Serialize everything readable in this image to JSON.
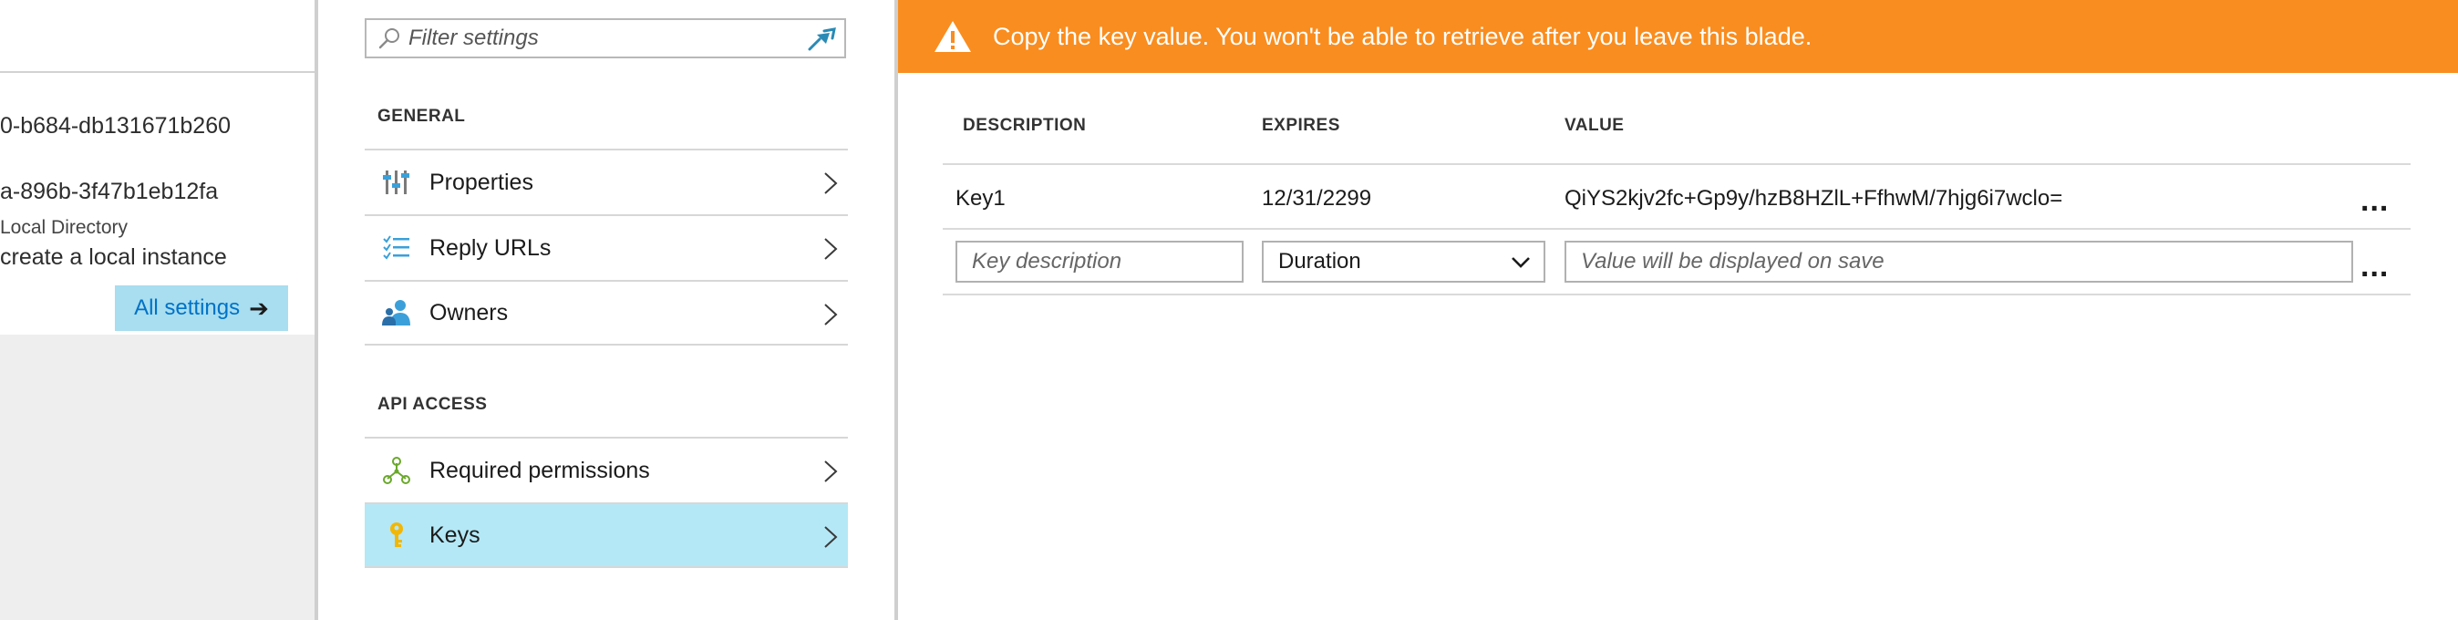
{
  "left_blade": {
    "line1": "0-b684-db131671b260",
    "line2": "a-896b-3f47b1eb12fa",
    "line3": "Local Directory",
    "line4": "create a local instance",
    "all_settings_label": "All settings",
    "all_settings_arrow": "➔"
  },
  "settings_blade": {
    "filter_placeholder": "Filter settings",
    "sections": [
      {
        "title": "GENERAL",
        "items": [
          {
            "label": "Properties",
            "icon": "properties-icon"
          },
          {
            "label": "Reply URLs",
            "icon": "reply-urls-icon"
          },
          {
            "label": "Owners",
            "icon": "owners-icon"
          }
        ]
      },
      {
        "title": "API ACCESS",
        "items": [
          {
            "label": "Required permissions",
            "icon": "permissions-icon"
          },
          {
            "label": "Keys",
            "icon": "key-icon",
            "selected": true
          }
        ]
      }
    ]
  },
  "keys_blade": {
    "warning": "Copy the key value. You won't be able to retrieve after you leave this blade.",
    "columns": {
      "description": "DESCRIPTION",
      "expires": "EXPIRES",
      "value": "VALUE"
    },
    "rows": [
      {
        "description": "Key1",
        "expires": "12/31/2299",
        "value": "QiYS2kjv2fc+Gp9y/hzB8HZlL+FfhwM/7hjg6i7wclo="
      }
    ],
    "new_row": {
      "description_placeholder": "Key description",
      "duration_value": "Duration",
      "value_placeholder": "Value will be displayed on save"
    },
    "more_label": "...",
    "colors": {
      "warning_bg": "#f98d1f",
      "selected_bg": "#b4e8f6",
      "link": "#0072c6"
    }
  }
}
